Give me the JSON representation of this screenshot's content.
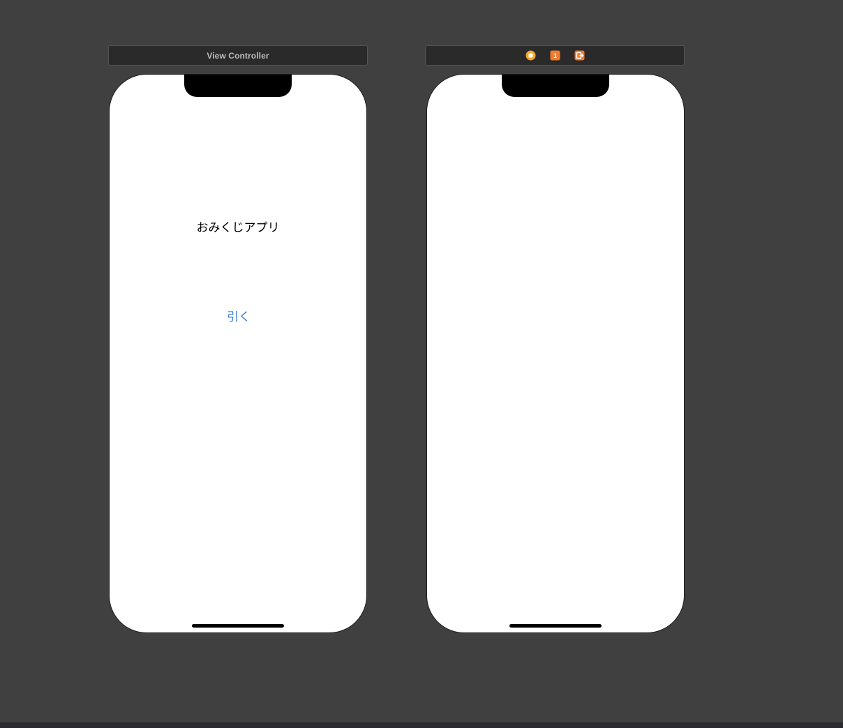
{
  "scenes": [
    {
      "title": "View Controller",
      "label_text": "おみくじアプリ",
      "button_label": "引く"
    },
    {
      "dock_icons": [
        {
          "name": "view-controller-icon",
          "color": "#f5a623"
        },
        {
          "name": "first-responder-icon",
          "color": "#f07b2e",
          "glyph": "1"
        },
        {
          "name": "exit-icon",
          "color": "#f07b2e"
        }
      ]
    }
  ],
  "colors": {
    "canvas_background": "#404040",
    "scene_bar_background": "#2a2a2a",
    "device_background": "#ffffff",
    "button_tint": "#2f7fd0",
    "label_text": "#000000"
  }
}
